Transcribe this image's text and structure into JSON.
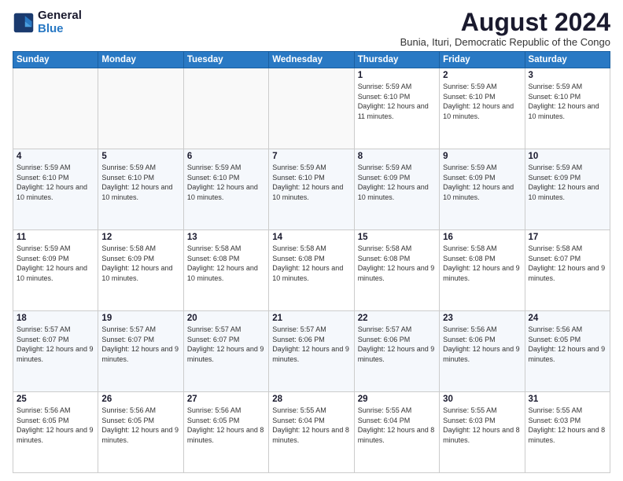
{
  "logo": {
    "line1": "General",
    "line2": "Blue"
  },
  "title": "August 2024",
  "subtitle": "Bunia, Ituri, Democratic Republic of the Congo",
  "days_of_week": [
    "Sunday",
    "Monday",
    "Tuesday",
    "Wednesday",
    "Thursday",
    "Friday",
    "Saturday"
  ],
  "weeks": [
    [
      {
        "day": "",
        "info": ""
      },
      {
        "day": "",
        "info": ""
      },
      {
        "day": "",
        "info": ""
      },
      {
        "day": "",
        "info": ""
      },
      {
        "day": "1",
        "info": "Sunrise: 5:59 AM\nSunset: 6:10 PM\nDaylight: 12 hours\nand 11 minutes."
      },
      {
        "day": "2",
        "info": "Sunrise: 5:59 AM\nSunset: 6:10 PM\nDaylight: 12 hours\nand 10 minutes."
      },
      {
        "day": "3",
        "info": "Sunrise: 5:59 AM\nSunset: 6:10 PM\nDaylight: 12 hours\nand 10 minutes."
      }
    ],
    [
      {
        "day": "4",
        "info": "Sunrise: 5:59 AM\nSunset: 6:10 PM\nDaylight: 12 hours\nand 10 minutes."
      },
      {
        "day": "5",
        "info": "Sunrise: 5:59 AM\nSunset: 6:10 PM\nDaylight: 12 hours\nand 10 minutes."
      },
      {
        "day": "6",
        "info": "Sunrise: 5:59 AM\nSunset: 6:10 PM\nDaylight: 12 hours\nand 10 minutes."
      },
      {
        "day": "7",
        "info": "Sunrise: 5:59 AM\nSunset: 6:10 PM\nDaylight: 12 hours\nand 10 minutes."
      },
      {
        "day": "8",
        "info": "Sunrise: 5:59 AM\nSunset: 6:09 PM\nDaylight: 12 hours\nand 10 minutes."
      },
      {
        "day": "9",
        "info": "Sunrise: 5:59 AM\nSunset: 6:09 PM\nDaylight: 12 hours\nand 10 minutes."
      },
      {
        "day": "10",
        "info": "Sunrise: 5:59 AM\nSunset: 6:09 PM\nDaylight: 12 hours\nand 10 minutes."
      }
    ],
    [
      {
        "day": "11",
        "info": "Sunrise: 5:59 AM\nSunset: 6:09 PM\nDaylight: 12 hours\nand 10 minutes."
      },
      {
        "day": "12",
        "info": "Sunrise: 5:58 AM\nSunset: 6:09 PM\nDaylight: 12 hours\nand 10 minutes."
      },
      {
        "day": "13",
        "info": "Sunrise: 5:58 AM\nSunset: 6:08 PM\nDaylight: 12 hours\nand 10 minutes."
      },
      {
        "day": "14",
        "info": "Sunrise: 5:58 AM\nSunset: 6:08 PM\nDaylight: 12 hours\nand 10 minutes."
      },
      {
        "day": "15",
        "info": "Sunrise: 5:58 AM\nSunset: 6:08 PM\nDaylight: 12 hours\nand 9 minutes."
      },
      {
        "day": "16",
        "info": "Sunrise: 5:58 AM\nSunset: 6:08 PM\nDaylight: 12 hours\nand 9 minutes."
      },
      {
        "day": "17",
        "info": "Sunrise: 5:58 AM\nSunset: 6:07 PM\nDaylight: 12 hours\nand 9 minutes."
      }
    ],
    [
      {
        "day": "18",
        "info": "Sunrise: 5:57 AM\nSunset: 6:07 PM\nDaylight: 12 hours\nand 9 minutes."
      },
      {
        "day": "19",
        "info": "Sunrise: 5:57 AM\nSunset: 6:07 PM\nDaylight: 12 hours\nand 9 minutes."
      },
      {
        "day": "20",
        "info": "Sunrise: 5:57 AM\nSunset: 6:07 PM\nDaylight: 12 hours\nand 9 minutes."
      },
      {
        "day": "21",
        "info": "Sunrise: 5:57 AM\nSunset: 6:06 PM\nDaylight: 12 hours\nand 9 minutes."
      },
      {
        "day": "22",
        "info": "Sunrise: 5:57 AM\nSunset: 6:06 PM\nDaylight: 12 hours\nand 9 minutes."
      },
      {
        "day": "23",
        "info": "Sunrise: 5:56 AM\nSunset: 6:06 PM\nDaylight: 12 hours\nand 9 minutes."
      },
      {
        "day": "24",
        "info": "Sunrise: 5:56 AM\nSunset: 6:05 PM\nDaylight: 12 hours\nand 9 minutes."
      }
    ],
    [
      {
        "day": "25",
        "info": "Sunrise: 5:56 AM\nSunset: 6:05 PM\nDaylight: 12 hours\nand 9 minutes."
      },
      {
        "day": "26",
        "info": "Sunrise: 5:56 AM\nSunset: 6:05 PM\nDaylight: 12 hours\nand 9 minutes."
      },
      {
        "day": "27",
        "info": "Sunrise: 5:56 AM\nSunset: 6:05 PM\nDaylight: 12 hours\nand 8 minutes."
      },
      {
        "day": "28",
        "info": "Sunrise: 5:55 AM\nSunset: 6:04 PM\nDaylight: 12 hours\nand 8 minutes."
      },
      {
        "day": "29",
        "info": "Sunrise: 5:55 AM\nSunset: 6:04 PM\nDaylight: 12 hours\nand 8 minutes."
      },
      {
        "day": "30",
        "info": "Sunrise: 5:55 AM\nSunset: 6:03 PM\nDaylight: 12 hours\nand 8 minutes."
      },
      {
        "day": "31",
        "info": "Sunrise: 5:55 AM\nSunset: 6:03 PM\nDaylight: 12 hours\nand 8 minutes."
      }
    ]
  ]
}
